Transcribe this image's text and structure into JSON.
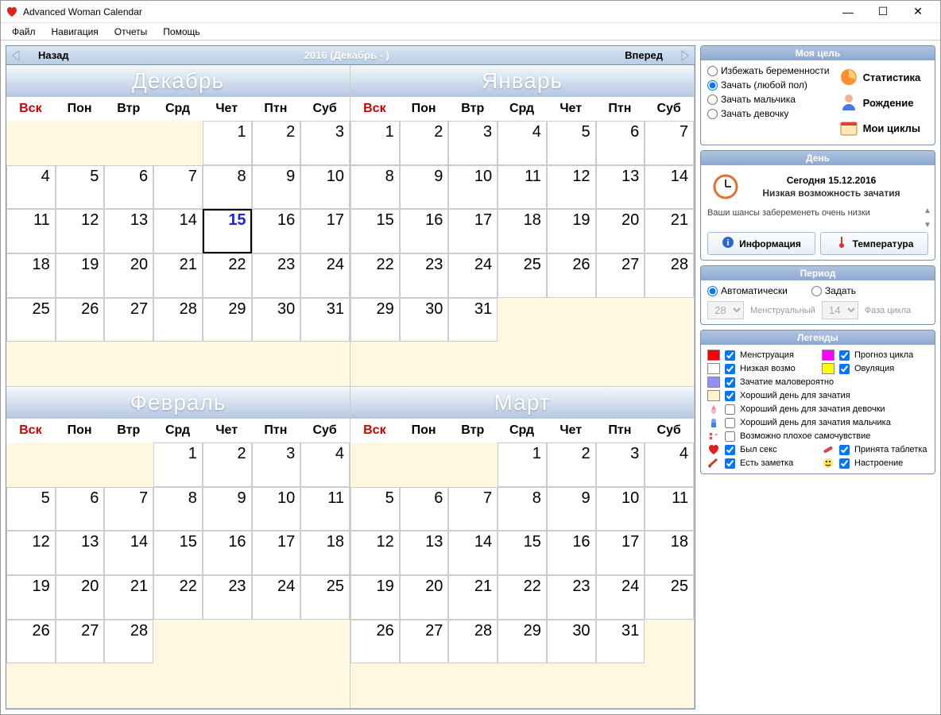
{
  "window": {
    "title": "Advanced Woman Calendar"
  },
  "menu": [
    "Файл",
    "Навигация",
    "Отчеты",
    "Помощь"
  ],
  "nav": {
    "back": "Назад",
    "forward": "Вперед",
    "title": "2016 (Декабрь - )"
  },
  "weekdays": [
    "Вск",
    "Пон",
    "Втр",
    "Срд",
    "Чет",
    "Птн",
    "Суб"
  ],
  "months": [
    {
      "name": "Декабрь",
      "start": 4,
      "days": 31,
      "today": 15
    },
    {
      "name": "Январь",
      "start": 0,
      "days": 31
    },
    {
      "name": "Февраль",
      "start": 3,
      "days": 28
    },
    {
      "name": "Март",
      "start": 3,
      "days": 31
    }
  ],
  "goal": {
    "header": "Моя цель",
    "options": [
      "Избежать беременности",
      "Зачать (любой пол)",
      "Зачать мальчика",
      "Зачать девочку"
    ],
    "selected": 1,
    "buttons": [
      "Статистика",
      "Рождение",
      "Мои циклы"
    ]
  },
  "day": {
    "header": "День",
    "today_label": "Сегодня 15.12.2016",
    "subtitle": "Низкая возможность зачатия",
    "detail": "Ваши шансы забеременеть очень низки",
    "info_btn": "Информация",
    "temp_btn": "Температура"
  },
  "period": {
    "header": "Период",
    "auto": "Автоматически",
    "manual": "Задать",
    "selected": "auto",
    "cycle_len": "28",
    "cycle_label": "Менструальный",
    "phase_len": "14",
    "phase_label": "Фаза цикла"
  },
  "legends": {
    "header": "Легенды",
    "row1a": {
      "label": "Менструация",
      "color": "#ff0000",
      "checked": true
    },
    "row1b": {
      "label": "Прогноз цикла",
      "color": "#ff00ff",
      "checked": true
    },
    "row2a": {
      "label": "Низкая возмо",
      "color": "#ffffff",
      "checked": true
    },
    "row2b": {
      "label": "Овуляция",
      "color": "#ffff00",
      "checked": true
    },
    "row3": {
      "label": "Зачатие маловероятно",
      "color": "#9090ff",
      "checked": true
    },
    "row4": {
      "label": "Хороший день для зачатия",
      "color": "#fff1c8",
      "checked": true
    },
    "row5": {
      "label": "Хороший день для зачатия девочки",
      "icon": "girl-icon",
      "checked": false
    },
    "row6": {
      "label": "Хороший день для зачатия мальчика",
      "icon": "boy-icon",
      "checked": false
    },
    "row7": {
      "label": "Возможно плохое самочувствие",
      "icon": "unwell-icon",
      "checked": false
    },
    "row8a": {
      "label": "Был секс",
      "icon": "heart-icon",
      "checked": true
    },
    "row8b": {
      "label": "Принята таблетка",
      "icon": "pill-icon",
      "checked": true
    },
    "row9a": {
      "label": "Есть заметка",
      "icon": "note-icon",
      "checked": true
    },
    "row9b": {
      "label": "Настроение",
      "icon": "mood-icon",
      "checked": true
    }
  }
}
